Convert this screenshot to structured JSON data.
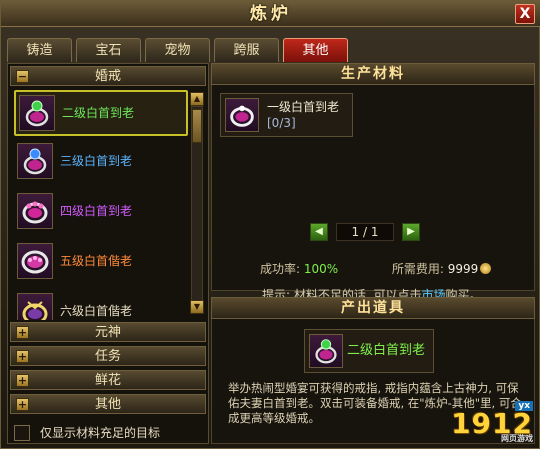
{
  "window": {
    "title": "炼炉",
    "close_label": "X"
  },
  "tabs": [
    {
      "label": "铸造"
    },
    {
      "label": "宝石"
    },
    {
      "label": "宠物"
    },
    {
      "label": "跨服"
    },
    {
      "label": "其他",
      "active": true
    }
  ],
  "left": {
    "open_category": {
      "toggle": "−",
      "label": "婚戒"
    },
    "items": [
      {
        "label": "二级白首到老",
        "color": "#6ee85a",
        "selected": true
      },
      {
        "label": "三级白首到老",
        "color": "#5ab4ff"
      },
      {
        "label": "四级白首到老",
        "color": "#d35aff"
      },
      {
        "label": "五级白首偕老",
        "color": "#ff8a3a"
      },
      {
        "label": "六级白首偕老",
        "color": "#e6dcc0"
      }
    ],
    "collapsed_categories": [
      {
        "toggle": "+",
        "label": "元神"
      },
      {
        "toggle": "+",
        "label": "任务"
      },
      {
        "toggle": "+",
        "label": "鲜花"
      },
      {
        "toggle": "+",
        "label": "其他"
      }
    ],
    "scroll_up": "▲",
    "scroll_down": "▼",
    "checkbox_label": "仅显示材料充足的目标"
  },
  "materials": {
    "title": "生产材料",
    "item_name": "一级白首到老",
    "item_count": "[0/3]",
    "pager": {
      "prev": "◀",
      "text": "1 / 1",
      "next": "▶"
    },
    "success_label": "成功率:",
    "success_value": "100%",
    "cost_label": "所需费用:",
    "cost_value": "9999",
    "hint_prefix": "提示: 材料不足的话, 可以点击",
    "hint_link": "市场",
    "hint_suffix": "购买。"
  },
  "output": {
    "title": "产出道具",
    "item_name": "二级白首到老",
    "description": "举办热闹型婚宴可获得的戒指, 戒指内蕴含上古神力, 可保佑夫妻白首到老。双击可装备婚戒, 在\"炼炉-其他\"里, 可合成更高等级婚戒。"
  },
  "watermark": {
    "main": "1912",
    "tag": "yx",
    "sub": "网页游戏"
  }
}
